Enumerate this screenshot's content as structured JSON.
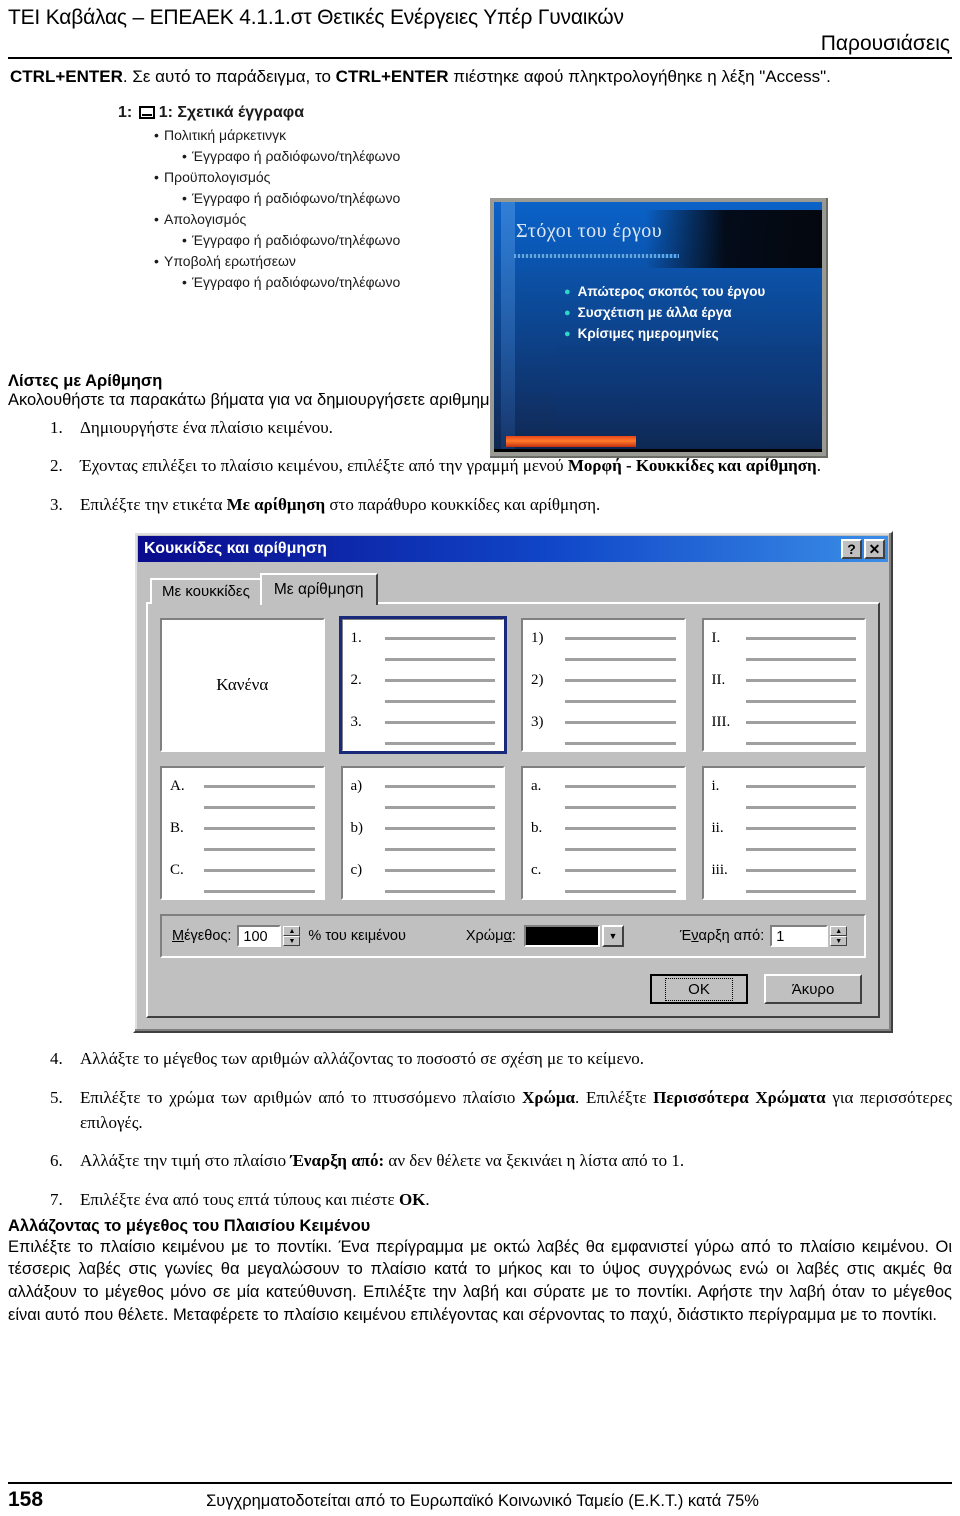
{
  "header": {
    "institution": "ΤΕΙ Καβάλας – ΕΠΕΑΕΚ 4.1.1.στ Θετικές Ενέργειες Υπέρ Γυναικών",
    "section": "Παρουσιάσεις"
  },
  "intro": {
    "part1": "CTRL+ENTER",
    "part2": ". Σε αυτό το παράδειγμα, το ",
    "part3": "CTRL+ENTER",
    "part4": " πιέστηκε αφού πληκτρολογήθηκε η λέξη \"Access\"."
  },
  "screenshot": {
    "outline": {
      "title": "1: Σχετικά έγγραφα",
      "items": [
        {
          "level": 1,
          "text": "Πολιτική μάρκετινγκ"
        },
        {
          "level": 2,
          "text": "Έγγραφο ή ραδιόφωνο/τηλέφωνο"
        },
        {
          "level": 1,
          "text": "Προϋπολογισμός"
        },
        {
          "level": 2,
          "text": "Έγγραφο ή ραδιόφωνο/τηλέφωνο"
        },
        {
          "level": 1,
          "text": "Απολογισμός"
        },
        {
          "level": 2,
          "text": "Έγγραφο ή ραδιόφωνο/τηλέφωνο"
        },
        {
          "level": 1,
          "text": "Υποβολή ερωτήσεων"
        },
        {
          "level": 2,
          "text": "Έγγραφο ή ραδιόφωνο/τηλέφωνο"
        }
      ]
    },
    "slide": {
      "title": "Στόχοι του έργου",
      "bullets": [
        "Απώτερος σκοπός του έργου",
        "Συσχέτιση με άλλα έργα",
        "Κρίσιμες ημερομηνίες"
      ],
      "bullet_color": "#2fd6c8",
      "bg_color": "#0c4fa2",
      "accent_color": "#e8441b"
    }
  },
  "numbered_lists_section": {
    "heading": "Λίστες με Αρίθμηση",
    "subheading": "Ακολουθήστε τα παρακάτω βήματα για να δημιουργήσετε αριθμημένες λίστες:",
    "steps_before": [
      {
        "num": "1.",
        "pre": "Δημιουργήστε ένα πλαίσιο κειμένου.",
        "bold": "",
        "post": ""
      },
      {
        "num": "2.",
        "pre": "Έχοντας επιλέξει το πλαίσιο κειμένου, επιλέξτε από την γραμμή μενού ",
        "bold": "Μορφή - Κουκκίδες και αρίθμηση",
        "post": "."
      },
      {
        "num": "3.",
        "pre": "Επιλέξτε την ετικέτα ",
        "bold": "Με αρίθμηση",
        "post": " στο παράθυρο κουκκίδες και αρίθμηση."
      }
    ],
    "steps_after": [
      {
        "num": "4.",
        "pre": "Αλλάξτε το μέγεθος των αριθμών αλλάζοντας το ποσοστό σε σχέση με το κείμενο.",
        "bold": "",
        "post": "",
        "bold2": "",
        "post2": ""
      },
      {
        "num": "5.",
        "pre": "Επιλέξτε το χρώμα των αριθμών από το πτυσσόμενο πλαίσιο ",
        "bold": "Χρώμα",
        "post": ". Επιλέξτε ",
        "bold2": "Περισσότερα Χρώματα",
        "post2": "  για περισσότερες επιλογές."
      },
      {
        "num": "6.",
        "pre": "Αλλάξτε την τιμή στο πλαίσιο ",
        "bold": "Έναρξη από:",
        "post": " αν δεν θέλετε να ξεκινάει η λίστα από το 1.",
        "bold2": "",
        "post2": ""
      },
      {
        "num": "7.",
        "pre": "Επιλέξτε ένα από τους επτά τύπους και πιέστε ",
        "bold": "OK",
        "post": ".",
        "bold2": "",
        "post2": ""
      }
    ]
  },
  "dialog": {
    "title": "Κουκκίδες και αρίθμηση",
    "help_button": "?",
    "close_button": "✕",
    "tabs": [
      {
        "label": "Με κουκκίδες",
        "active": false
      },
      {
        "label": "Με αρίθμηση",
        "active": true
      }
    ],
    "previews": [
      {
        "type": "none",
        "label": "Κανένα",
        "selected": false,
        "markers": []
      },
      {
        "type": "numbers",
        "label": "",
        "selected": true,
        "markers": [
          "1.",
          "2.",
          "3."
        ]
      },
      {
        "type": "numbers-paren",
        "label": "",
        "selected": false,
        "markers": [
          "1)",
          "2)",
          "3)"
        ]
      },
      {
        "type": "roman-upper",
        "label": "",
        "selected": false,
        "markers": [
          "I.",
          "II.",
          "III."
        ]
      },
      {
        "type": "alpha-upper",
        "label": "",
        "selected": false,
        "markers": [
          "A.",
          "B.",
          "C."
        ]
      },
      {
        "type": "alpha-lower-paren",
        "label": "",
        "selected": false,
        "markers": [
          "a)",
          "b)",
          "c)"
        ]
      },
      {
        "type": "alpha-lower",
        "label": "",
        "selected": false,
        "markers": [
          "a.",
          "b.",
          "c."
        ]
      },
      {
        "type": "roman-lower",
        "label": "",
        "selected": false,
        "markers": [
          "i.",
          "ii.",
          "iii."
        ]
      }
    ],
    "size": {
      "label": "Μέγεθος:",
      "value": "100",
      "suffix": "% του κειμένου"
    },
    "color": {
      "label": "Χρώμα:",
      "value": "#000000"
    },
    "start_at": {
      "label": "Έναρξη από:",
      "value": "1"
    },
    "buttons": {
      "ok": "OK",
      "cancel": "Άκυρο"
    }
  },
  "textbox_section": {
    "heading": "Αλλάζοντας το μέγεθος του Πλαισίου Κειμένου",
    "body": "Επιλέξτε το πλαίσιο κειμένου με το ποντίκι. Ένα περίγραμμα με οκτώ λαβές θα εμφανιστεί γύρω από το πλαίσιο κειμένου. Οι τέσσερις λαβές στις γωνίες θα μεγαλώσουν το πλαίσιο κατά το μήκος και το ύψος συγχρόνως ενώ οι λαβές στις ακμές θα αλλάξουν το μέγεθος μόνο σε μία κατεύθυνση. Επιλέξτε την λαβή και σύρατε με το ποντίκι. Αφήστε την λαβή όταν το μέγεθος είναι αυτό που θέλετε. Μεταφέρετε το πλαίσιο κειμένου επιλέγοντας και σέρνοντας το παχύ, διάστικτο περίγραμμα με το ποντίκι."
  },
  "footer": {
    "page_number": "158",
    "text": "Συγχρηματοδοτείται από το Ευρωπαϊκό Κοινωνικό Ταμείο (Ε.Κ.Τ.) κατά 75%"
  }
}
